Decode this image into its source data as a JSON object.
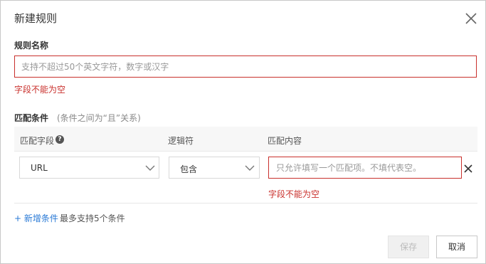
{
  "dialog": {
    "title": "新建规则",
    "close_icon": "close-icon"
  },
  "rule_name": {
    "label": "规则名称",
    "placeholder": "支持不超过50个英文字符，数字或汉字",
    "value": "",
    "error": "字段不能为空"
  },
  "conditions": {
    "label": "匹配条件",
    "hint": "(条件之间为“且”关系)",
    "columns": {
      "field": "匹配字段",
      "operator": "逻辑符",
      "content": "匹配内容"
    },
    "help_icon": "help-icon",
    "rows": [
      {
        "field": "URL",
        "operator": "包含",
        "content_placeholder": "只允许填写一个匹配项。不填代表空。",
        "content_value": "",
        "error": "字段不能为空"
      }
    ],
    "add_label": "+ 新增条件",
    "add_note": "最多支持5个条件"
  },
  "footer": {
    "save_label": "保存",
    "cancel_label": "取消"
  },
  "colors": {
    "error": "#c9302c",
    "link": "#2a7ad6"
  }
}
